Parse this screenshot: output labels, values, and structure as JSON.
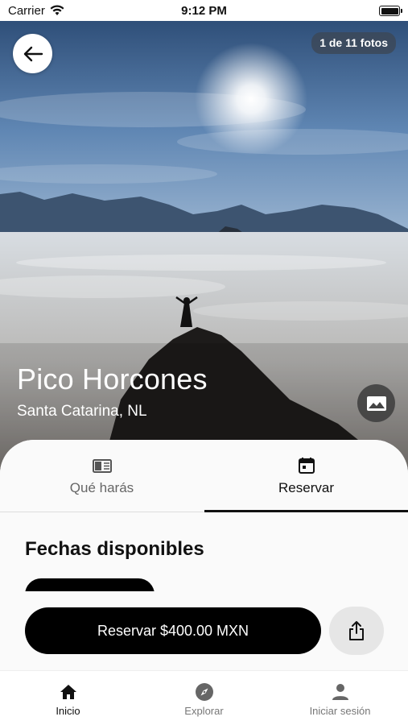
{
  "status_bar": {
    "carrier": "Carrier",
    "time": "9:12 PM"
  },
  "hero": {
    "photo_count": "1 de 11 fotos",
    "title": "Pico Horcones",
    "subtitle": "Santa Catarina, NL"
  },
  "tabs": [
    {
      "label": "Qué harás",
      "icon": "book-icon",
      "active": false
    },
    {
      "label": "Reservar",
      "icon": "calendar-icon",
      "active": true
    }
  ],
  "section": {
    "title": "Fechas disponibles"
  },
  "actions": {
    "reserve_label": "Reservar $400.00 MXN",
    "share_icon": "share-icon"
  },
  "nav": [
    {
      "label": "Inicio",
      "icon": "home-icon",
      "active": true
    },
    {
      "label": "Explorar",
      "icon": "compass-icon",
      "active": false
    },
    {
      "label": "Iniciar sesión",
      "icon": "person-icon",
      "active": false
    }
  ],
  "colors": {
    "primary": "#000000",
    "sheet_background": "#fafafa",
    "inactive_text": "#666666"
  }
}
